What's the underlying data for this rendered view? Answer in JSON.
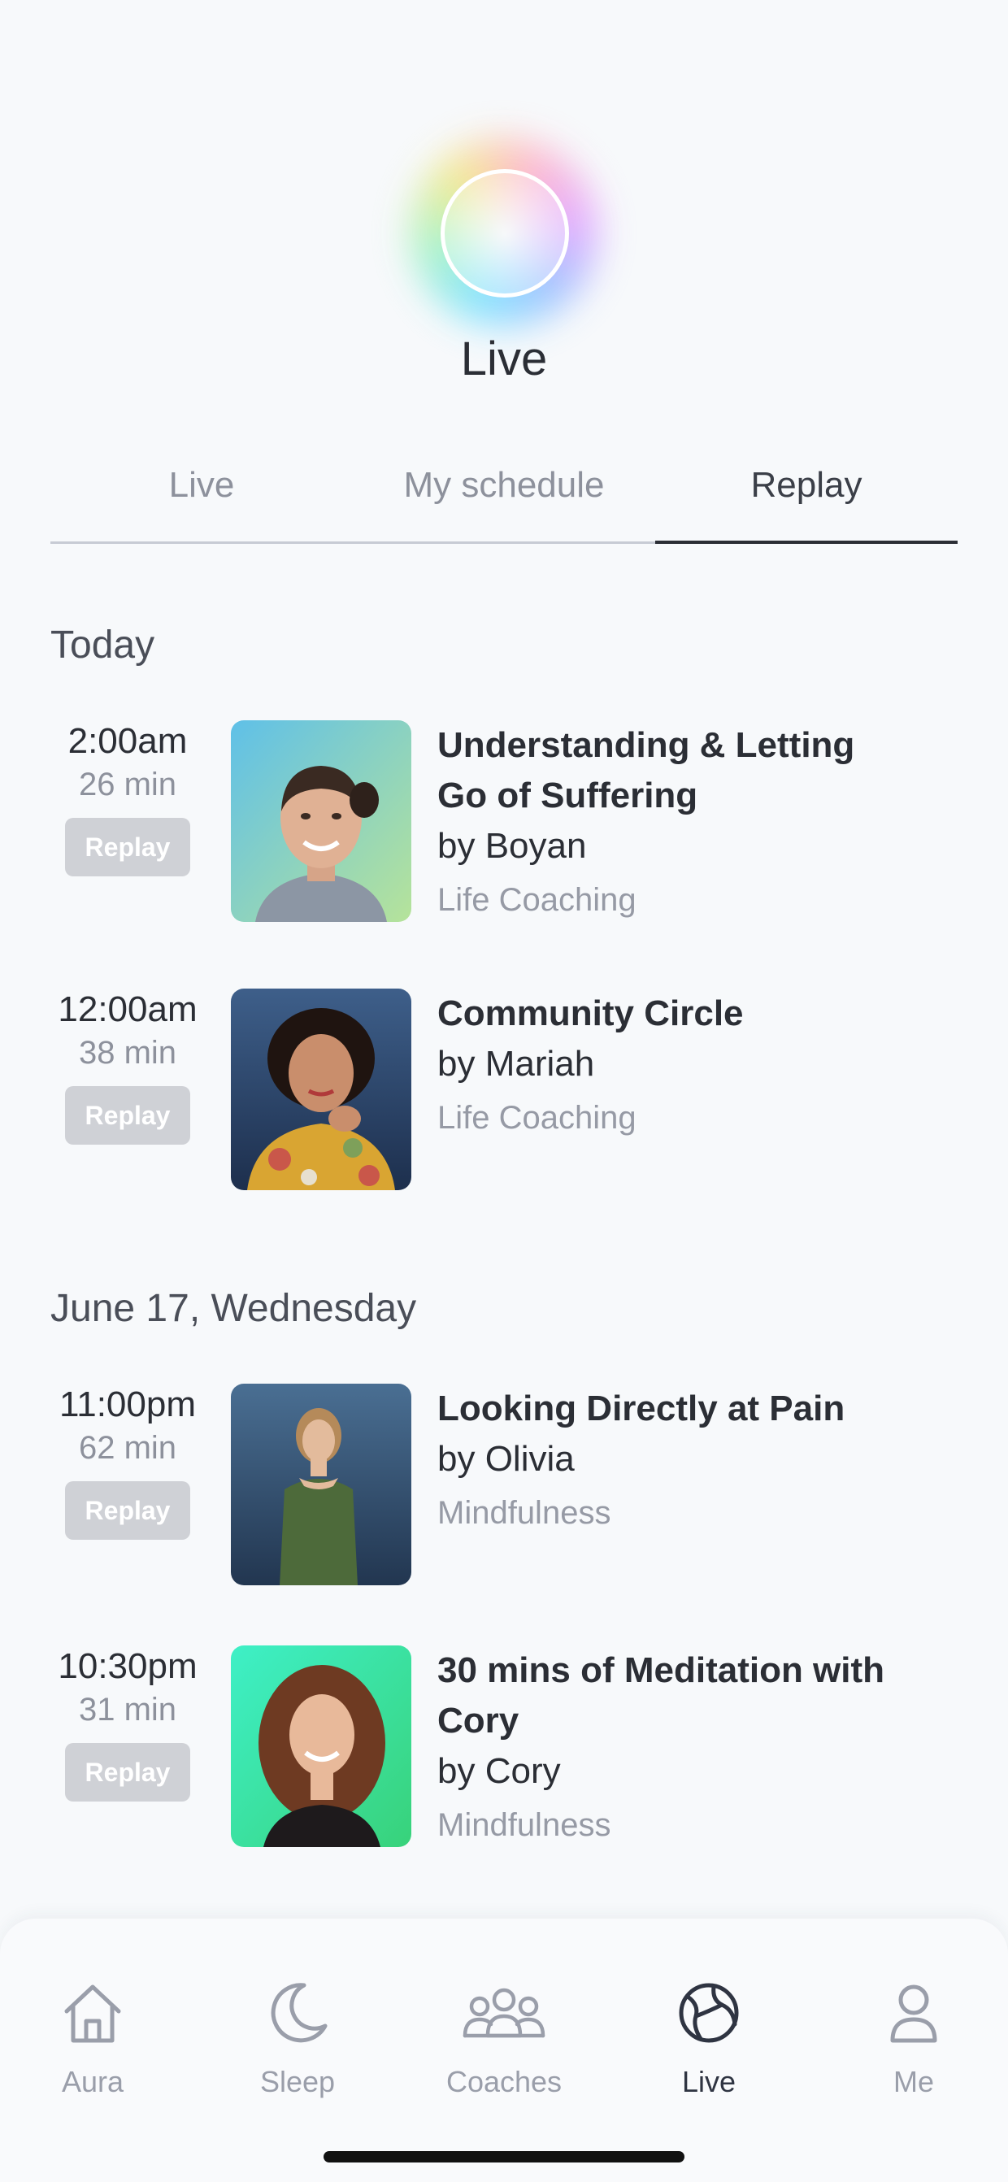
{
  "header": {
    "title": "Live"
  },
  "tabs": [
    {
      "label": "Live",
      "active": false
    },
    {
      "label": "My schedule",
      "active": false
    },
    {
      "label": "Replay",
      "active": true
    }
  ],
  "sections": [
    {
      "title": "Today",
      "sessions": [
        {
          "time": "2:00am",
          "duration": "26 min",
          "button_label": "Replay",
          "title_lines": [
            "Understanding & Letting",
            "Go of Suffering"
          ],
          "coach": "by Boyan",
          "category": "Life Coaching"
        },
        {
          "time": "12:00am",
          "duration": "38 min",
          "button_label": "Replay",
          "title_lines": [
            "Community Circle"
          ],
          "coach": "by Mariah",
          "category": "Life Coaching"
        }
      ]
    },
    {
      "title": "June 17, Wednesday",
      "sessions": [
        {
          "time": "11:00pm",
          "duration": "62 min",
          "button_label": "Replay",
          "title_lines": [
            "Looking Directly at Pain"
          ],
          "coach": "by Olivia",
          "category": "Mindfulness"
        },
        {
          "time": "10:30pm",
          "duration": "31 min",
          "button_label": "Replay",
          "title_lines": [
            "30 mins of Meditation with",
            "Cory"
          ],
          "coach": "by Cory",
          "category": "Mindfulness"
        }
      ]
    }
  ],
  "bottom_nav": [
    {
      "label": "Aura",
      "icon": "home-icon",
      "active": false
    },
    {
      "label": "Sleep",
      "icon": "moon-icon",
      "active": false
    },
    {
      "label": "Coaches",
      "icon": "people-icon",
      "active": false
    },
    {
      "label": "Live",
      "icon": "globe-icon",
      "active": true
    },
    {
      "label": "Me",
      "icon": "person-icon",
      "active": false
    }
  ],
  "colors": {
    "background": "#f7f9fb",
    "text_primary": "#2b2e35",
    "text_secondary": "#8d919c",
    "replay_button": "#cfd1d6"
  }
}
